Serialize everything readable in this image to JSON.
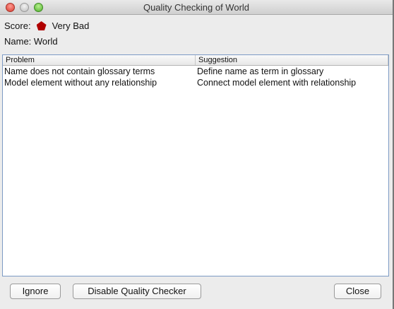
{
  "window": {
    "title": "Quality Checking of World"
  },
  "score": {
    "label": "Score:",
    "value": "Very Bad",
    "color": "#b00000",
    "icon": "pentagon-icon"
  },
  "name": {
    "label": "Name: World"
  },
  "table": {
    "columns": [
      "Problem",
      "Suggestion"
    ],
    "rows": [
      [
        "Name does not contain glossary terms",
        "Define name as term in glossary"
      ],
      [
        "Model element without any relationship",
        "Connect model element with relationship"
      ]
    ]
  },
  "buttons": {
    "ignore": "Ignore",
    "disable": "Disable Quality Checker",
    "close": "Close"
  }
}
